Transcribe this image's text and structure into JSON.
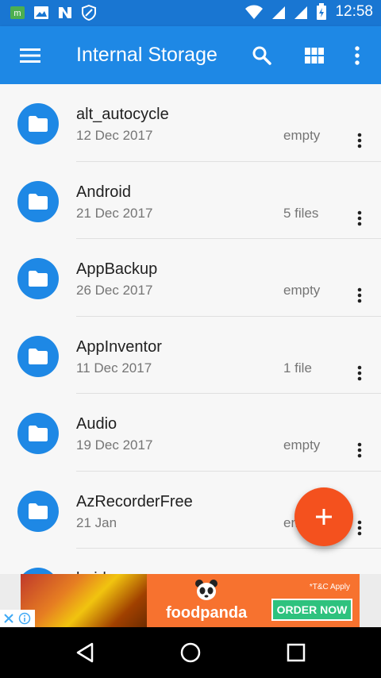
{
  "status_bar": {
    "time": "12:58",
    "icons": [
      "app-m-icon",
      "image-icon",
      "n-icon",
      "vpn-icon",
      "wifi-icon",
      "signal-icon",
      "signal-icon-2",
      "battery-charging-icon"
    ]
  },
  "app_bar": {
    "title": "Internal Storage",
    "icons": [
      "menu-icon",
      "search-icon",
      "grid-view-icon",
      "more-vert-icon"
    ],
    "color": "#1e88e5"
  },
  "folders": [
    {
      "name": "alt_autocycle",
      "date": "12 Dec 2017",
      "size": "empty"
    },
    {
      "name": "Android",
      "date": "21 Dec 2017",
      "size": "5 files"
    },
    {
      "name": "AppBackup",
      "date": "26 Dec 2017",
      "size": "empty"
    },
    {
      "name": "AppInventor",
      "date": "11 Dec 2017",
      "size": "1 file"
    },
    {
      "name": "Audio",
      "date": "19 Dec 2017",
      "size": "empty"
    },
    {
      "name": "AzRecorderFree",
      "date": "21 Jan",
      "size": "empty"
    },
    {
      "name": "baidu",
      "date": "",
      "size": ""
    }
  ],
  "fab": {
    "icon": "add-icon",
    "color": "#f4511e"
  },
  "ad": {
    "brand": "foodpanda",
    "tc": "*T&C Apply",
    "cta": "ORDER NOW",
    "icons": [
      "close-icon",
      "info-icon",
      "panda-icon"
    ]
  },
  "nav_bar": {
    "icons": [
      "back-icon",
      "home-icon",
      "recents-icon"
    ]
  }
}
